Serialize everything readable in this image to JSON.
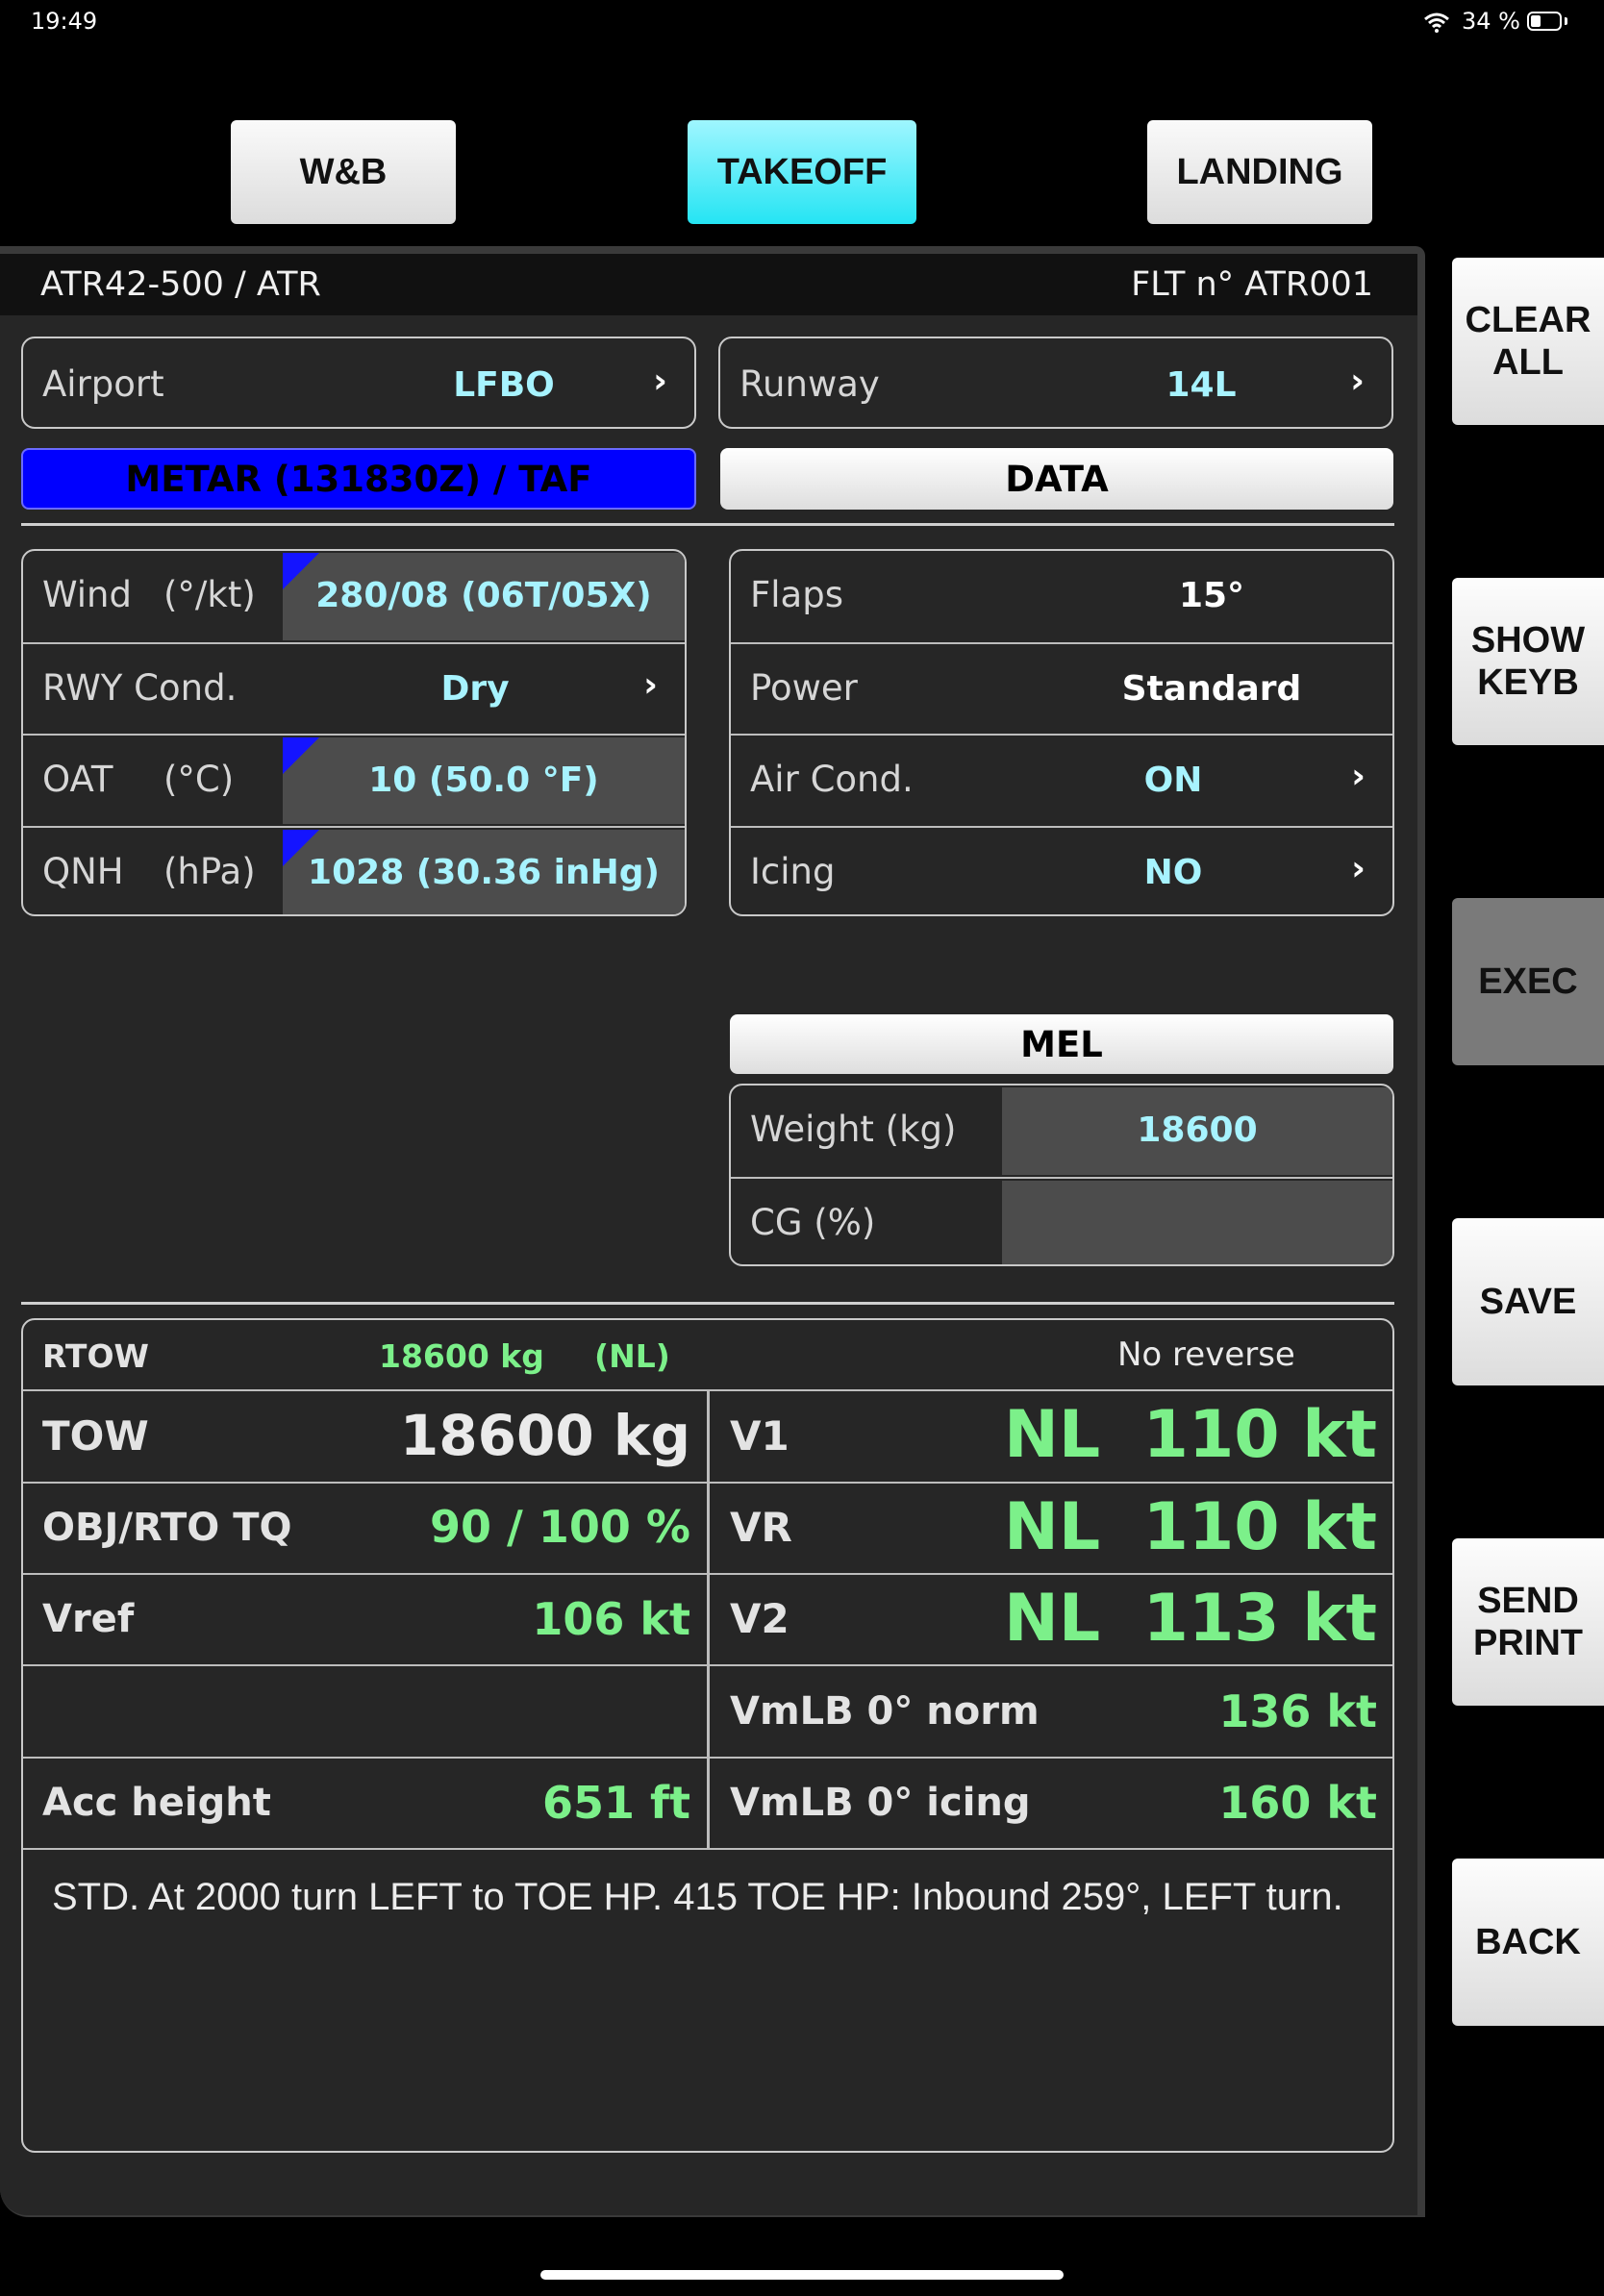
{
  "status_bar": {
    "time": "19:49",
    "battery_pct": "34 %",
    "battery_level": 0.34
  },
  "tabs": [
    {
      "label": "W&B",
      "active": false
    },
    {
      "label": "TAKEOFF",
      "active": true
    },
    {
      "label": "LANDING",
      "active": false
    }
  ],
  "header": {
    "aircraft": "ATR42-500 / ATR",
    "flight": "FLT n° ATR001"
  },
  "airport": {
    "label": "Airport",
    "value": "LFBO"
  },
  "runway": {
    "label": "Runway",
    "value": "14L"
  },
  "metar_button": "METAR (131830Z) / TAF",
  "data_button": "DATA",
  "conditions": [
    {
      "label": "Wind",
      "unit": "(°/kt)",
      "value": "280/08 (06T/05X)"
    },
    {
      "label": "RWY Cond.",
      "unit": "",
      "value": "Dry"
    },
    {
      "label": "OAT",
      "unit": "(°C)",
      "value": "10 (50.0 °F)"
    },
    {
      "label": "QNH",
      "unit": "(hPa)",
      "value": "1028 (30.36 inHg)"
    }
  ],
  "config": [
    {
      "label": "Flaps",
      "value": "15°"
    },
    {
      "label": "Power",
      "value": "Standard"
    },
    {
      "label": "Air Cond.",
      "value": "ON"
    },
    {
      "label": "Icing",
      "value": "NO"
    }
  ],
  "mel": {
    "title": "MEL",
    "weight_label": "Weight (kg)",
    "weight_value": "18600",
    "cg_label": "CG (%)",
    "cg_value": ""
  },
  "results": {
    "rtow_label": "RTOW",
    "rtow_value": "18600 kg",
    "rtow_flag": "(NL)",
    "reverse_note": "No reverse",
    "tow_label": "TOW",
    "tow_value": "18600 kg",
    "tq_label": "OBJ/RTO TQ",
    "tq_value": "90 / 100 %",
    "vref_label": "Vref",
    "vref_value": "106  kt",
    "acc_label": "Acc height",
    "acc_value": "651  ft",
    "v1_label": "V1",
    "v1_flag": "NL",
    "v1_value": "110 kt",
    "vr_label": "VR",
    "vr_flag": "NL",
    "vr_value": "110 kt",
    "v2_label": "V2",
    "v2_flag": "NL",
    "v2_value": "113 kt",
    "vmlb_norm_label": "VmLB 0° norm",
    "vmlb_norm_value": "136  kt",
    "vmlb_icing_label": "VmLB 0° icing",
    "vmlb_icing_value": "160  kt",
    "procedure": "STD. At 2000 turn LEFT to TOE HP. 415 TOE HP:  Inbound 259°, LEFT turn."
  },
  "side_buttons": {
    "clear": [
      "CLEAR",
      "ALL"
    ],
    "keyb": [
      "SHOW",
      "KEYB"
    ],
    "exec": [
      "EXEC"
    ],
    "save": [
      "SAVE"
    ],
    "send": [
      "SEND",
      "PRINT"
    ],
    "back": [
      "BACK"
    ]
  },
  "icons": {
    "wifi": "wifi-icon",
    "battery": "battery-icon",
    "chevron": "chevron-right-icon"
  }
}
